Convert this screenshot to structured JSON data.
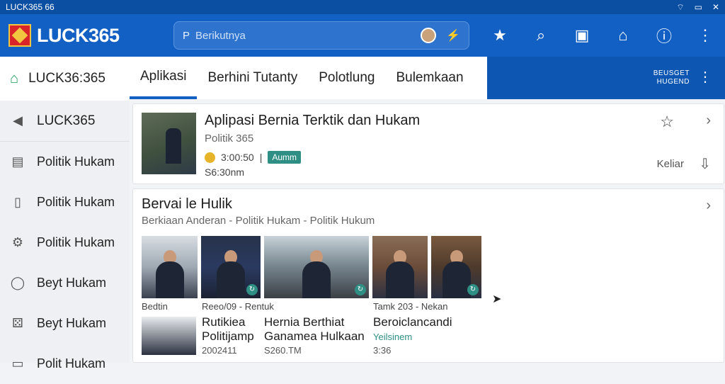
{
  "status_bar": {
    "left_text": "LUCK365 66",
    "wifi_icon": "wifi-icon"
  },
  "app_bar": {
    "logo_text": "LUCK365",
    "search": {
      "value": "Berikutnya",
      "prefix": "P"
    },
    "icons": [
      "star-icon",
      "search-icon",
      "bookmark-icon",
      "home-icon",
      "info-icon",
      "more-vertical-icon"
    ]
  },
  "sidebar": {
    "header": "LUCK36:365",
    "items": [
      {
        "label": "LUCK365",
        "icon": "back-icon"
      },
      {
        "label": "Politik Hukam",
        "icon": "document-icon"
      },
      {
        "label": "Politik Hukam",
        "icon": "file-icon"
      },
      {
        "label": "Politik Hukam",
        "icon": "settings-icon"
      },
      {
        "label": "Beyt Hukam",
        "icon": "location-icon"
      },
      {
        "label": "Beyt Hukam",
        "icon": "dice-icon"
      },
      {
        "label": "Polit Hukam",
        "icon": "doc-icon"
      }
    ]
  },
  "tabs": [
    {
      "label": "Aplikasi",
      "active": true
    },
    {
      "label": "Berhini Tutanty",
      "active": false
    },
    {
      "label": "Polotlung",
      "active": false
    },
    {
      "label": "Bulemkaan",
      "active": false
    }
  ],
  "tab_ext": {
    "line1": "BEUSGET",
    "line2": "HUGEND"
  },
  "card1": {
    "title": "Aplipasi Bernia Terktik dan Hukam",
    "subtitle": "Politik 365",
    "price": "3:00:50",
    "tag": "Aumm",
    "time": "S6:30nm",
    "action": "Keliar"
  },
  "card2": {
    "title": "Bervai le Hulik",
    "subtitle": "Berkiaan Anderan - Politik Hukam - Politik Hukum",
    "captions": [
      "Bedtin",
      "Reeo/09 - Rentuk",
      "Tamk 203 - Nekan"
    ],
    "news": [
      {
        "title": "Rutikiea Politijamp",
        "meta": "2002411"
      },
      {
        "title": "Hernia Berthiat Ganamea Hulkaan",
        "meta": "S260.TM"
      },
      {
        "title": "Beroiclancandi",
        "meta": "Yeilsinem",
        "meta2": "3:36"
      }
    ]
  }
}
